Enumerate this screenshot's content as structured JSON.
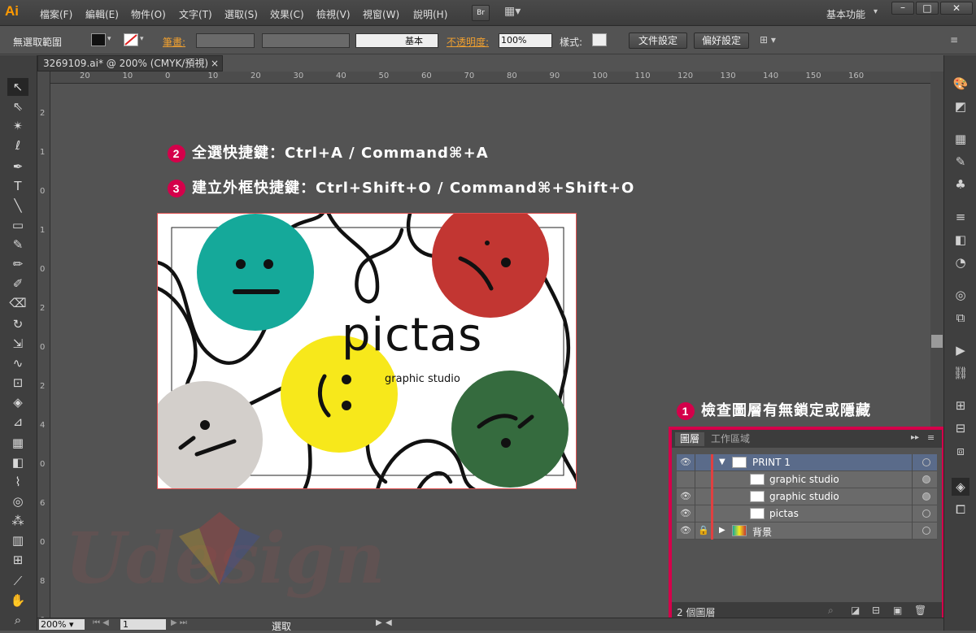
{
  "app": {
    "logo": "Ai"
  },
  "menu": [
    "檔案(F)",
    "編輯(E)",
    "物件(O)",
    "文字(T)",
    "選取(S)",
    "效果(C)",
    "檢視(V)",
    "視窗(W)",
    "說明(H)"
  ],
  "menu_extra": {
    "bridge": "Br",
    "workspace": "基本功能"
  },
  "control": {
    "selection": "無選取範圍",
    "stroke_label": "筆畫:",
    "stroke_style": "基本",
    "opacity_label": "不透明度:",
    "opacity_value": "100%",
    "style_label": "樣式:",
    "doc_setup": "文件設定",
    "prefs": "偏好設定"
  },
  "doc_tab": {
    "title": "3269109.ai* @ 200% (CMYK/預視)",
    "close": "×"
  },
  "ruler_h": [
    "20",
    "10",
    "0",
    "10",
    "20",
    "30",
    "40",
    "50",
    "60",
    "70",
    "80",
    "90",
    "100",
    "110",
    "120",
    "130",
    "140",
    "150",
    "160"
  ],
  "ruler_v": [
    "2",
    "1",
    "0",
    "1",
    "0",
    "2",
    "0",
    "2",
    "4",
    "0",
    "6",
    "0",
    "8",
    "0"
  ],
  "annotations": {
    "step2": {
      "num": "2",
      "text": "全選快捷鍵：Ctrl+A / Command⌘+A"
    },
    "step3": {
      "num": "3",
      "text": "建立外框快捷鍵：Ctrl+Shift+O / Command⌘+Shift+O"
    },
    "step1": {
      "num": "1",
      "text": "檢查圖層有無鎖定或隱藏"
    }
  },
  "artwork": {
    "title": "pictas",
    "subtitle": "graphic studio"
  },
  "colors": {
    "teal": "#15a99a",
    "red": "#c23632",
    "yellow": "#f7e81b",
    "green": "#356b3e",
    "grey": "#d3cfcb"
  },
  "layers_panel": {
    "tab_layers": "圖層",
    "tab_artboards": "工作區域",
    "rows": [
      {
        "name": "PRINT 1",
        "expanded": true,
        "selected": true,
        "visible": true
      },
      {
        "name": "graphic studio",
        "visible": false
      },
      {
        "name": "graphic studio",
        "visible": true
      },
      {
        "name": "pictas",
        "visible": true
      },
      {
        "name": "背景",
        "locked": true,
        "visible": true
      }
    ],
    "footer": "2 個圖層"
  },
  "status": {
    "zoom": "200%",
    "artboard": "1",
    "tool": "選取"
  },
  "watermark": "Udesign"
}
